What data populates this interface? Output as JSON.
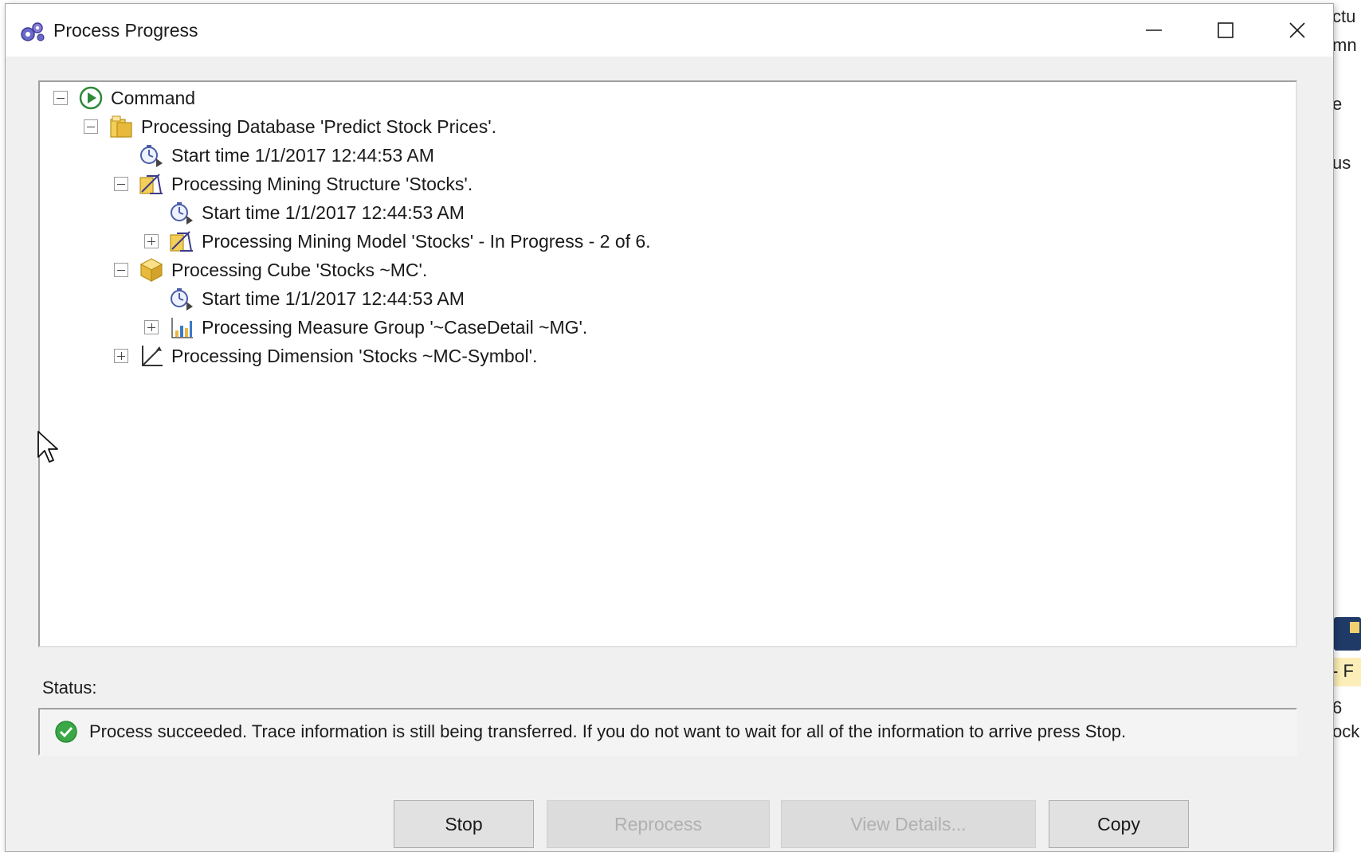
{
  "window": {
    "title": "Process Progress"
  },
  "background_window": {
    "fragments": [
      "ctu",
      "mn",
      "e",
      "us",
      "- F",
      "6",
      "ock"
    ]
  },
  "tree": {
    "nodes": [
      {
        "label": "Command",
        "icon": "play-circle-icon",
        "toggle": "collapse"
      },
      {
        "label": "Processing Database 'Predict Stock Prices'.",
        "icon": "database-icon",
        "toggle": "collapse"
      },
      {
        "label": "Start time 1/1/2017 12:44:53 AM",
        "icon": "stopwatch-icon",
        "toggle": "none"
      },
      {
        "label": "Processing Mining Structure 'Stocks'.",
        "icon": "mining-structure-icon",
        "toggle": "collapse"
      },
      {
        "label": "Start time 1/1/2017 12:44:53 AM",
        "icon": "stopwatch-icon",
        "toggle": "none"
      },
      {
        "label": "Processing Mining Model 'Stocks' - In Progress - 2 of 6.",
        "icon": "mining-model-icon",
        "toggle": "expand"
      },
      {
        "label": "Processing Cube 'Stocks ~MC'.",
        "icon": "cube-icon",
        "toggle": "collapse"
      },
      {
        "label": "Start time 1/1/2017 12:44:53 AM",
        "icon": "stopwatch-icon",
        "toggle": "none"
      },
      {
        "label": "Processing Measure Group '~CaseDetail ~MG'.",
        "icon": "measure-group-icon",
        "toggle": "expand"
      },
      {
        "label": "Processing Dimension 'Stocks ~MC-Symbol'.",
        "icon": "dimension-icon",
        "toggle": "expand"
      }
    ]
  },
  "status": {
    "label": "Status:",
    "message": "Process succeeded. Trace information is still being transferred. If you do not want to wait for all of the information to arrive press Stop."
  },
  "buttons": {
    "stop": "Stop",
    "reprocess": "Reprocess",
    "view_details": "View Details...",
    "copy": "Copy"
  },
  "colors": {
    "success": "#3aa845",
    "folder_yellow": "#e8b93a",
    "play_green": "#2e8b3a"
  }
}
